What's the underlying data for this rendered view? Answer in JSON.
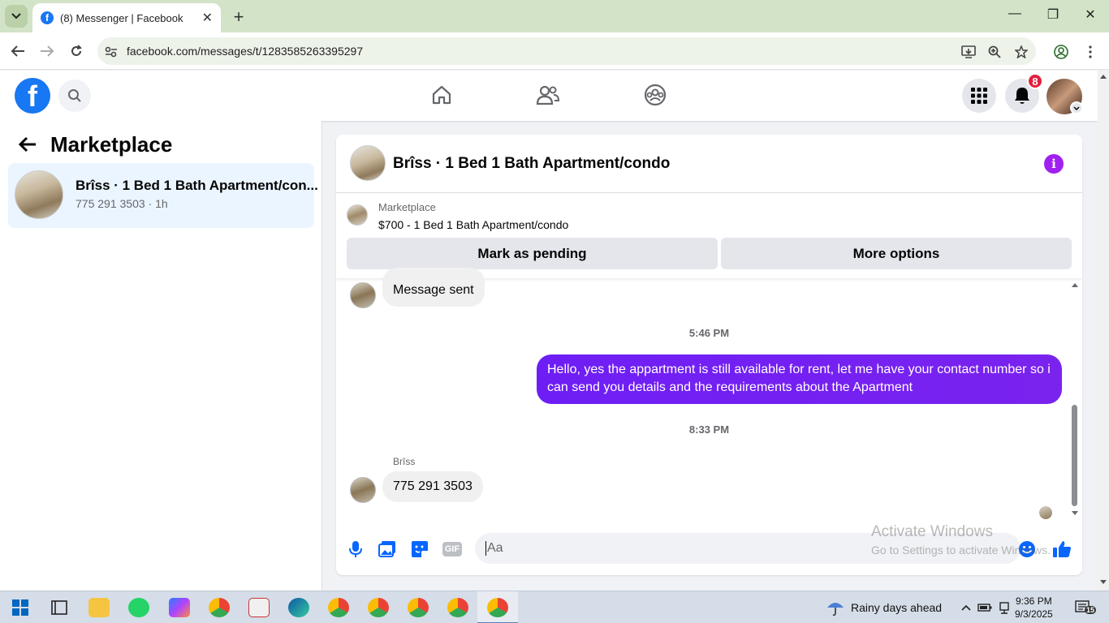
{
  "browser": {
    "tab_title": "(8) Messenger | Facebook",
    "tab_favicon": "f",
    "tab_close": "✕",
    "new_tab": "+",
    "url": "facebook.com/messages/t/1283585263395297",
    "window_min": "—",
    "window_restore": "❐",
    "window_close": "✕"
  },
  "facebook": {
    "logo": "f",
    "notification_count": "8",
    "accent_color": "#1877f2"
  },
  "sidebar": {
    "title": "Marketplace",
    "conversations": [
      {
        "name": "Brîss · 1 Bed 1 Bath Apartment/con...",
        "subtitle": "775 291 3503 · 1h"
      }
    ]
  },
  "chat": {
    "title": "Brîss · 1 Bed 1 Bath Apartment/condo",
    "info_icon": "i",
    "listing": {
      "label": "Marketplace",
      "price_title": "$700 - 1 Bed 1 Bath Apartment/condo"
    },
    "buttons": {
      "mark_pending": "Mark as pending",
      "more_options": "More options"
    },
    "messages": [
      {
        "type": "incoming",
        "text": "Message sent"
      },
      {
        "type": "timestamp",
        "text": "5:46 PM"
      },
      {
        "type": "outgoing",
        "text": "Hello, yes the appartment is still available for rent, let me have your contact number so i can send you details and the requirements about the  Apartment"
      },
      {
        "type": "timestamp",
        "text": "8:33 PM"
      },
      {
        "type": "sender",
        "text": "Brîss"
      },
      {
        "type": "incoming",
        "text": "775 291 3503"
      }
    ],
    "composer": {
      "placeholder": "Aa",
      "gif_label": "GIF"
    },
    "outgoing_color": "#7a23ee"
  },
  "watermark": {
    "line1": "Activate Windows",
    "line2": "Go to Settings to activate Windows."
  },
  "taskbar": {
    "weather": "Rainy days ahead",
    "time": "9:36 PM",
    "date": "9/3/2025",
    "notifications": "15"
  }
}
